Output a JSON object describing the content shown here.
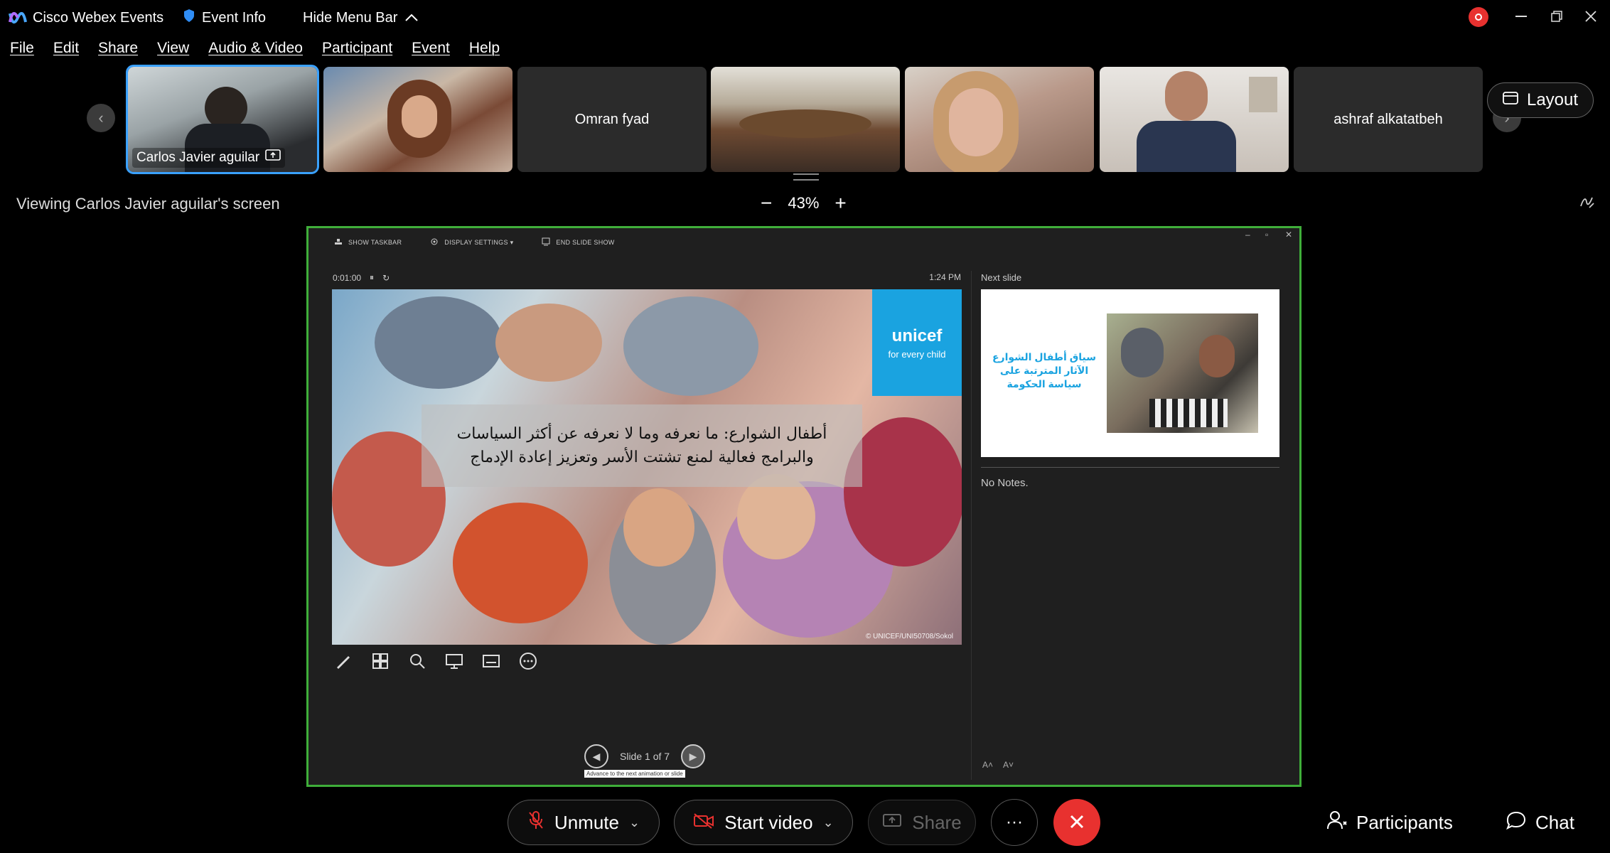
{
  "titlebar": {
    "app_name": "Cisco Webex Events",
    "event_info": "Event Info",
    "hide_menu": "Hide Menu Bar",
    "record_color": "#e8312f"
  },
  "menu": [
    "File",
    "Edit",
    "Share",
    "View",
    "Audio & Video",
    "Participant",
    "Event",
    "Help"
  ],
  "filmstrip": {
    "tiles": [
      {
        "name": "Carlos  Javier aguilar",
        "kind": "video",
        "active": true
      },
      {
        "name": "",
        "kind": "video"
      },
      {
        "name": "Omran fyad",
        "kind": "name"
      },
      {
        "name": "",
        "kind": "video"
      },
      {
        "name": "",
        "kind": "video"
      },
      {
        "name": "",
        "kind": "video"
      },
      {
        "name": "ashraf alkatatbeh",
        "kind": "name"
      }
    ],
    "layout_label": "Layout"
  },
  "viewing": {
    "text": "Viewing Carlos  Javier aguilar's screen",
    "zoom_minus": "−",
    "zoom_level": "43%",
    "zoom_plus": "+"
  },
  "presenter": {
    "toolbar": {
      "show_taskbar": "SHOW TASKBAR",
      "display_settings": "DISPLAY SETTINGS ▾",
      "end_slide_show": "END SLIDE SHOW"
    },
    "timer": "0:01:00",
    "clock": "1:24 PM",
    "slide": {
      "title_line1": "أطفال الشوارع: ما نعرفه وما لا نعرفه عن أكثر السياسات",
      "title_line2": "والبرامج فعالية لمنع تشتت الأسر وتعزيز إعادة الإدماج",
      "unicef_logo": "unicef",
      "unicef_tag": "for every child",
      "credit": "© UNICEF/UNI50708/Sokol"
    },
    "slide_counter": "Slide 1 of 7",
    "nav_tooltip": "Advance to the next animation or slide",
    "next_slide_label": "Next slide",
    "next_slide_title": "سياق أطفال الشوارع الآثار المترتبة على سياسة الحكومة",
    "notes": "No Notes."
  },
  "controls": {
    "unmute": "Unmute",
    "start_video": "Start video",
    "share": "Share",
    "more": "···",
    "participants": "Participants",
    "chat": "Chat"
  }
}
